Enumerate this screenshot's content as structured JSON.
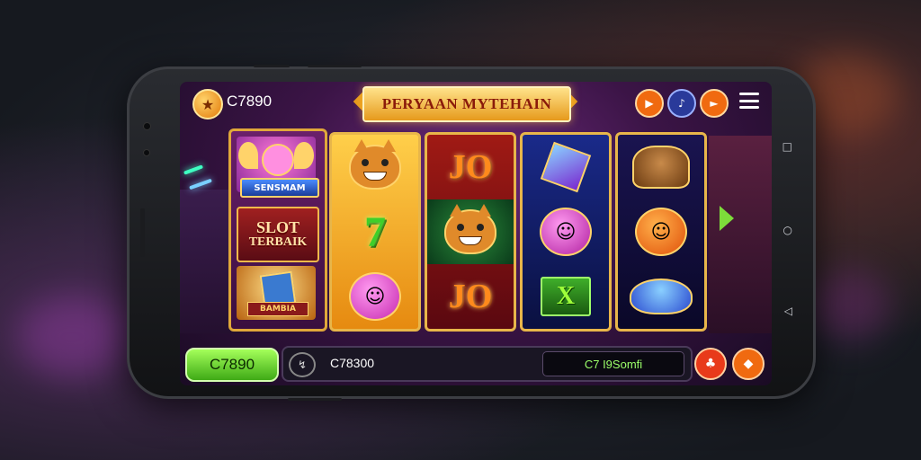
{
  "top_bar": {
    "balance": "C7890",
    "title": "PERYAAN MYTEHAIN",
    "coin_icon": "star-coin-icon",
    "buttons": [
      "play-icon",
      "sound-icon",
      "forward-icon",
      "menu-icon"
    ]
  },
  "side_panel": {
    "top_label": "SENSMAM",
    "slot_line1": "SLOT",
    "slot_line2": "TERBAIK",
    "bottom_label": "BAMBIA"
  },
  "reels": {
    "symbol_jo": "JO",
    "symbol_seven": "7",
    "symbol_x": "X"
  },
  "bottom_bar": {
    "spin_label": "C7890",
    "bet_value": "C78300",
    "win_text": "C7 I9Somfi",
    "right_buttons": [
      "clover-icon",
      "diamond-icon"
    ]
  },
  "colors": {
    "accent_gold": "#e8b64a",
    "spin_green": "#5fd424",
    "button_orange": "#f06a10"
  }
}
